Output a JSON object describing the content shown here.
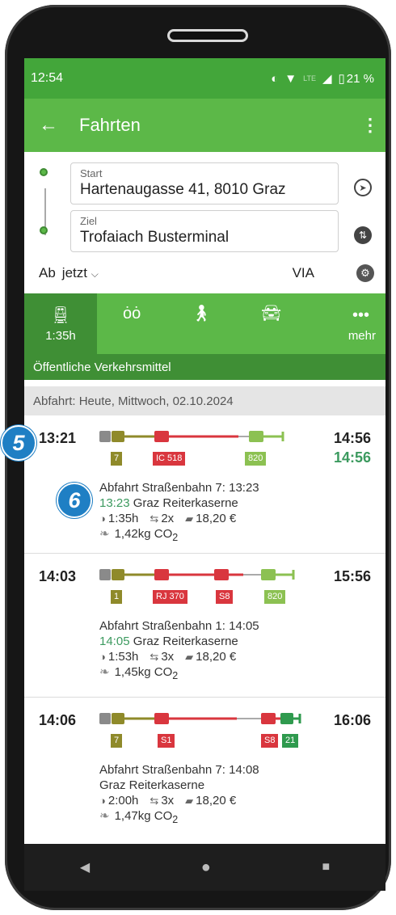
{
  "status_bar": {
    "time": "12:54",
    "network": "LTE",
    "battery": "21 %"
  },
  "app_bar": {
    "back_icon": "arrow-left-icon",
    "title": "Fahrten",
    "menu_icon": "more-vert-icon"
  },
  "search": {
    "start_label": "Start",
    "start_value": "Hartenaugasse 41, 8010 Graz",
    "ziel_label": "Ziel",
    "ziel_value": "Trofaiach Busterminal",
    "ab_label": "Ab",
    "time_value": "jetzt",
    "via_label": "VIA"
  },
  "modes": [
    {
      "icon": "train-icon",
      "label": "1:35h",
      "active": true
    },
    {
      "icon": "bike-icon",
      "label": ""
    },
    {
      "icon": "walk-icon",
      "label": ""
    },
    {
      "icon": "car-icon",
      "label": ""
    },
    {
      "icon": "more-icon",
      "label": "mehr"
    }
  ],
  "subheader": "Öffentliche Verkehrsmittel",
  "date_header": "Abfahrt: Heute, Mittwoch, 02.10.2024",
  "trips": [
    {
      "dep": "13:21",
      "arr": "14:56",
      "arr_realtime": "14:56",
      "badges": [
        "7",
        "IC 518",
        "820"
      ],
      "line1": "Abfahrt Straßenbahn 7: 13:23",
      "line2_time": "13:23",
      "line2_place": "Graz Reiterkaserne",
      "duration": "1:35h",
      "changes": "2x",
      "price": "18,20 €",
      "co2": "1,42kg CO",
      "co2_sub": "2"
    },
    {
      "dep": "14:03",
      "arr": "15:56",
      "badges": [
        "1",
        "RJ 370",
        "S8",
        "820"
      ],
      "line1": "Abfahrt Straßenbahn 1: 14:05",
      "line2_time": "14:05",
      "line2_place": "Graz Reiterkaserne",
      "duration": "1:53h",
      "changes": "3x",
      "price": "18,20 €",
      "co2": "1,45kg CO",
      "co2_sub": "2"
    },
    {
      "dep": "14:06",
      "arr": "16:06",
      "badges": [
        "7",
        "S1",
        "S8",
        "21"
      ],
      "line1": "Abfahrt Straßenbahn 7: 14:08",
      "line2_place": "Graz Reiterkaserne",
      "duration": "2:00h",
      "changes": "3x",
      "price": "18,20 €",
      "co2": "1,47kg CO",
      "co2_sub": "2"
    }
  ],
  "markers": [
    "5",
    "6"
  ],
  "colors": {
    "green": "#5cb848",
    "dark_green": "#3f8f35",
    "olive": "#8f8a2a",
    "red": "#d9363e",
    "light_green": "#8cc152",
    "teal_green": "#2f9a4e",
    "marker_blue": "#1f7fc4"
  }
}
